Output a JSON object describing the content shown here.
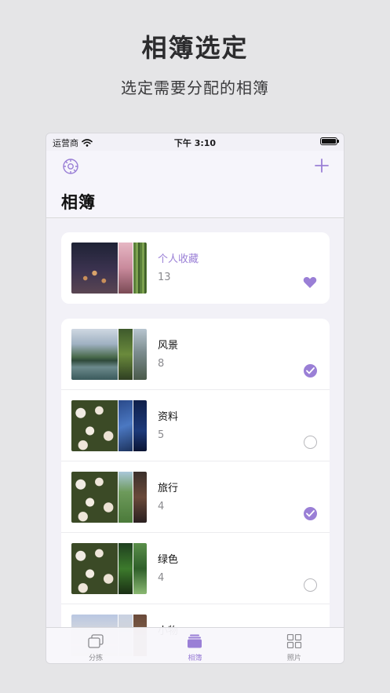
{
  "promo": {
    "title": "相簿选定",
    "subtitle": "选定需要分配的相簿"
  },
  "status_bar": {
    "carrier": "运营商",
    "time": "下午 3:10"
  },
  "nav": {
    "title": "相簿",
    "left_icon": "gear-icon",
    "right_icon": "plus-icon"
  },
  "favorites": {
    "name": "个人收藏",
    "count": "13",
    "icon": "heart-icon"
  },
  "albums": [
    {
      "name": "风景",
      "count": "8",
      "selected": true
    },
    {
      "name": "资料",
      "count": "5",
      "selected": false
    },
    {
      "name": "旅行",
      "count": "4",
      "selected": true
    },
    {
      "name": "绿色",
      "count": "4",
      "selected": false
    },
    {
      "name": "小物",
      "count": "",
      "selected": false
    }
  ],
  "tabs": [
    {
      "label": "分拣",
      "icon": "cards-icon",
      "active": false
    },
    {
      "label": "相簿",
      "icon": "album-stack-icon",
      "active": true
    },
    {
      "label": "照片",
      "icon": "grid-icon",
      "active": false
    }
  ],
  "colors": {
    "accent": "#9a7fd6",
    "background": "#f2f1f7",
    "outer_background": "#e5e5e7"
  }
}
